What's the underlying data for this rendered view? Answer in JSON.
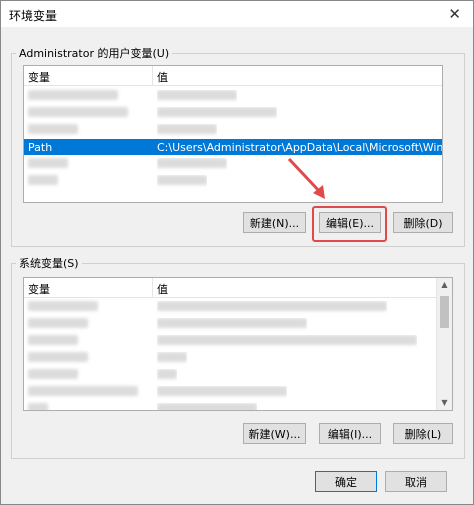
{
  "window": {
    "title": "环境变量",
    "close_glyph": "✕"
  },
  "user_group": {
    "legend": "Administrator 的用户变量(U)",
    "columns": [
      "变量",
      "值"
    ],
    "rows": [
      {
        "name": "",
        "value": "",
        "selected": false
      },
      {
        "name": "",
        "value": "",
        "selected": false
      },
      {
        "name": "",
        "value": "",
        "selected": false
      },
      {
        "name": "Path",
        "value": "C:\\Users\\Administrator\\AppData\\Local\\Microsoft\\WindowsA...",
        "selected": true
      },
      {
        "name": "",
        "value": "",
        "selected": false
      },
      {
        "name": "",
        "value": "",
        "selected": false
      }
    ],
    "buttons": {
      "new": "新建(N)...",
      "edit": "编辑(E)...",
      "delete": "删除(D)"
    }
  },
  "system_group": {
    "legend": "系统变量(S)",
    "columns": [
      "变量",
      "值"
    ],
    "buttons": {
      "new": "新建(W)...",
      "edit": "编辑(I)...",
      "delete": "删除(L)"
    }
  },
  "footer": {
    "ok": "确定",
    "cancel": "取消"
  },
  "colors": {
    "selection": "#0078d7",
    "annotation": "#e04a4a"
  }
}
